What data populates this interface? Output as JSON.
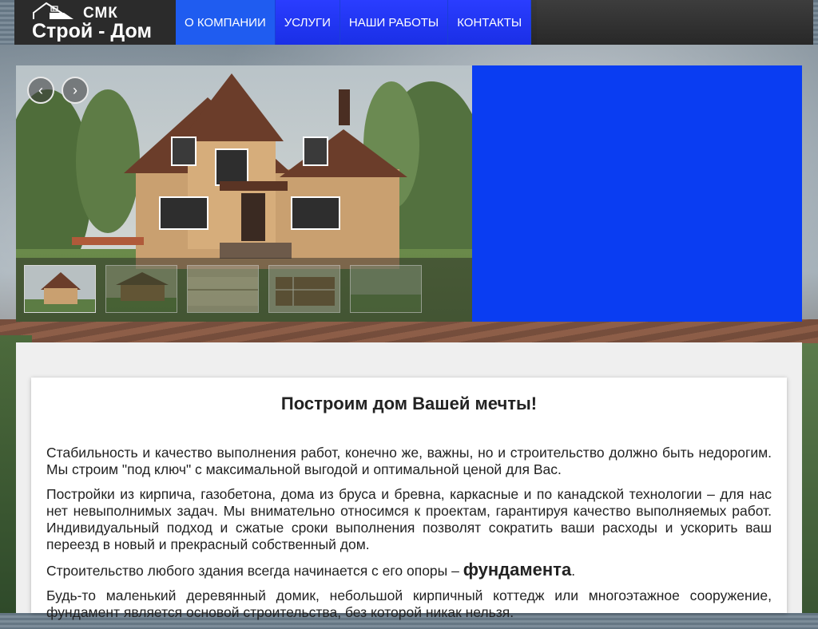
{
  "header": {
    "logo_small": "СМК",
    "logo_big": "Строй - Дом"
  },
  "nav": {
    "items": [
      {
        "label": "О КОМПАНИИ",
        "active": true
      },
      {
        "label": "УСЛУГИ",
        "active": false
      },
      {
        "label": "НАШИ РАБОТЫ",
        "active": false
      },
      {
        "label": "КОНТАКТЫ",
        "active": false
      }
    ]
  },
  "slider": {
    "prev_icon": "chevron-left-icon",
    "next_icon": "chevron-right-icon",
    "prev_glyph": "‹",
    "next_glyph": "›",
    "thumbnail_count": 5
  },
  "colors": {
    "nav_blue": "#1a2fe6",
    "nav_active": "#1f5cf0",
    "panel_blue": "#0a3df2"
  },
  "content": {
    "title": "Построим дом Вашей мечты!",
    "p1": "Стабильность и качество выполнения работ, конечно же, важны, но и строительство должно быть недорогим. Мы строим \"под ключ\" с максимальной выгодой и оптимальной ценой для Вас.",
    "p2": "Постройки из кирпича, газобетона, дома из бруса и бревна, каркасные и по канадской технологии – для нас нет невыполнимых задач. Мы внимательно относимся к проектам, гарантируя качество выполняемых работ. Индивидуальный подход и сжатые сроки выполнения позволят сократить ваши расходы и ускорить ваш переезд в новый и прекрасный собственный дом.",
    "p3_prefix": "Строительство любого здания всегда начинается с его опоры – ",
    "p3_bold": "фундамента",
    "p3_suffix": ".",
    "p4": "Будь-то маленький деревянный домик, небольшой кирпичный коттедж или многоэтажное сооружение, фундамент является основой строительства, без которой никак нельзя."
  }
}
